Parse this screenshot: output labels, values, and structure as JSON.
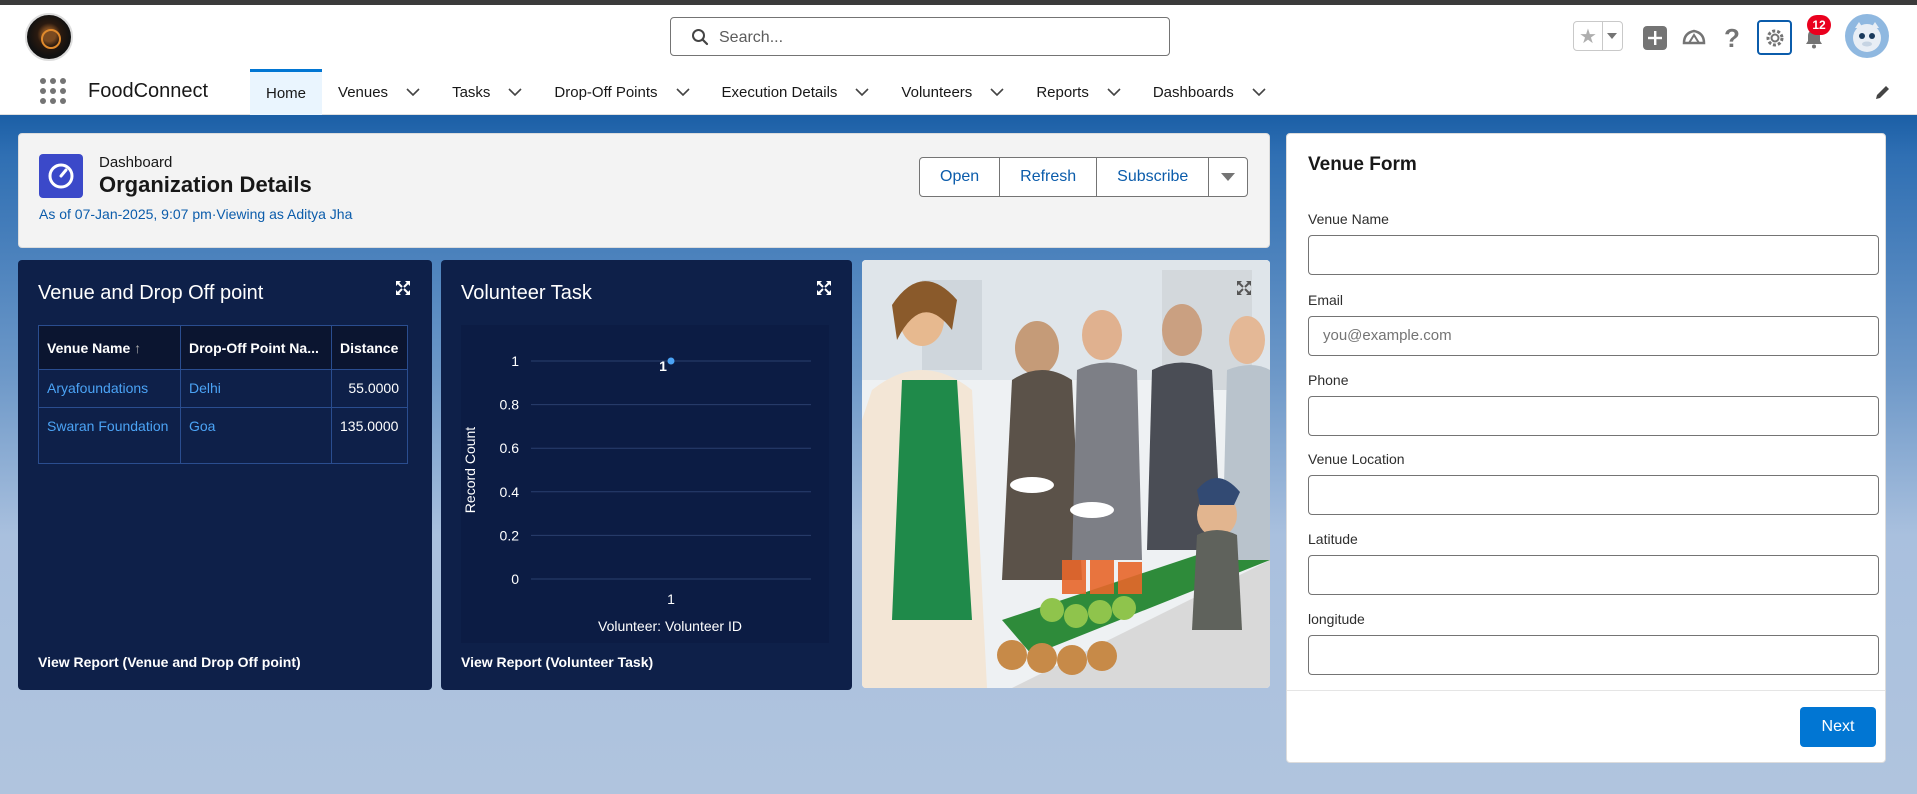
{
  "header": {
    "search_placeholder": "Search...",
    "notification_count": "12",
    "icons": [
      "search-icon",
      "star-icon",
      "chevron-down-icon",
      "plus-icon",
      "trailhead-icon",
      "help-icon",
      "gear-icon",
      "bell-icon",
      "avatar"
    ]
  },
  "nav": {
    "app_name": "FoodConnect",
    "tabs": [
      {
        "label": "Home",
        "active": true
      },
      {
        "label": "Venues"
      },
      {
        "label": "Tasks"
      },
      {
        "label": "Drop-Off Points"
      },
      {
        "label": "Execution Details"
      },
      {
        "label": "Volunteers"
      },
      {
        "label": "Reports"
      },
      {
        "label": "Dashboards"
      }
    ]
  },
  "dashboard": {
    "label": "Dashboard",
    "title": "Organization Details",
    "subtitle": "As of 07-Jan-2025, 9:07 pm·Viewing as Aditya Jha",
    "buttons": {
      "open": "Open",
      "refresh": "Refresh",
      "subscribe": "Subscribe"
    }
  },
  "venue_card": {
    "title": "Venue and Drop Off point",
    "columns": [
      "Venue Name",
      "Drop-Off Point Na...",
      "Distance"
    ],
    "rows": [
      {
        "venue": "Aryafoundations",
        "dropoff": "Delhi",
        "distance": "55.0000"
      },
      {
        "venue": "Swaran Foundation",
        "dropoff": "Goa",
        "distance": "135.0000"
      }
    ],
    "footer": "View Report (Venue and Drop Off point)"
  },
  "task_card": {
    "title": "Volunteer Task",
    "footer": "View Report (Volunteer Task)"
  },
  "chart_data": {
    "type": "scatter",
    "title": "Volunteer Task",
    "xlabel": "Volunteer: Volunteer ID",
    "ylabel": "Record Count",
    "categories": [
      "1"
    ],
    "y_ticks": [
      "1",
      "0.8",
      "0.6",
      "0.4",
      "0.2",
      "0"
    ],
    "ylim": [
      0,
      1
    ],
    "series": [
      {
        "values": [
          1
        ]
      }
    ],
    "data_labels": [
      "1"
    ],
    "grid": true
  },
  "form": {
    "title": "Venue Form",
    "fields": [
      {
        "label": "Venue Name",
        "value": "",
        "placeholder": ""
      },
      {
        "label": "Email",
        "value": "",
        "placeholder": "you@example.com"
      },
      {
        "label": "Phone",
        "value": "",
        "placeholder": ""
      },
      {
        "label": "Venue Location",
        "value": "",
        "placeholder": ""
      },
      {
        "label": "Latitude",
        "value": "",
        "placeholder": ""
      },
      {
        "label": "longitude",
        "value": "",
        "placeholder": ""
      }
    ],
    "next_label": "Next"
  },
  "colors": {
    "brand": "#0176d3",
    "card_bg": "#0e2049",
    "link": "#4ba3f5",
    "badge": "#ea001e"
  }
}
